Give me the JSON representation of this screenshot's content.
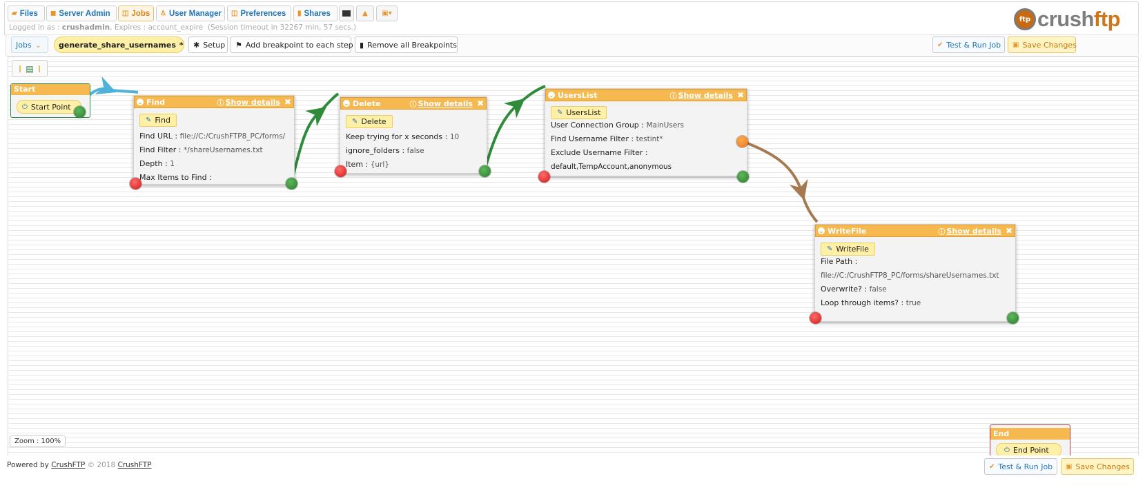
{
  "nav": {
    "tabs": [
      {
        "label": "Files",
        "icon": "folder-icon"
      },
      {
        "label": "Server Admin",
        "icon": "server-icon"
      },
      {
        "label": "Jobs",
        "icon": "jobs-icon",
        "active": true
      },
      {
        "label": "User Manager",
        "icon": "user-icon"
      },
      {
        "label": "Preferences",
        "icon": "preferences-icon"
      },
      {
        "label": "Shares",
        "icon": "shares-icon"
      }
    ]
  },
  "session": {
    "logged_in_label": "Logged in as :",
    "user": "crushadmin",
    "expires_label": ", Expires :",
    "expires_value": "account_expire",
    "timeout": "(Session timeout in 32267 min, 57 secs.)"
  },
  "logo": {
    "word_left": "crush",
    "word_right": "ftp"
  },
  "toolbar": {
    "jobs_label": "Jobs",
    "job_name": "generate_share_usernames",
    "modified_mark": "*",
    "setup_label": "Setup",
    "add_breakpoint_label": "Add breakpoint to each step",
    "remove_breakpoints_label": "Remove all Breakpoints",
    "test_run_label": "Test & Run Job",
    "save_label": "Save Changes"
  },
  "flow": {
    "start": {
      "title": "Start",
      "point_label": "Start Point"
    },
    "end": {
      "title": "End",
      "point_label": "End Point"
    },
    "show_details": "Show details",
    "nodes": [
      {
        "title": "Find",
        "chip": "Find",
        "fields": [
          {
            "label": "Find URL :",
            "value": "file://C:/CrushFTP8_PC/forms/"
          },
          {
            "label": "Find Filter :",
            "value": "*/shareUsernames.txt"
          },
          {
            "label": "Depth :",
            "value": "1"
          },
          {
            "label": "Max Items to Find :",
            "value": ""
          }
        ]
      },
      {
        "title": "Delete",
        "chip": "Delete",
        "fields": [
          {
            "label": "Keep trying for x seconds :",
            "value": "10"
          },
          {
            "label": "ignore_folders :",
            "value": "false"
          },
          {
            "label": "Item :",
            "value": "{url}"
          }
        ]
      },
      {
        "title": "UsersList",
        "chip": "UsersList",
        "fields": [
          {
            "label": "User Connection Group :",
            "value": "MainUsers"
          },
          {
            "label": "Find Username Filter :",
            "value": "testint*"
          },
          {
            "label": "Exclude Username Filter :",
            "value": ""
          },
          {
            "label": "",
            "value": "default,TempAccount,anonymous"
          }
        ]
      },
      {
        "title": "WriteFile",
        "chip": "WriteFile",
        "fields": [
          {
            "label": "File Path :",
            "value": ""
          },
          {
            "label": "",
            "value": "file://C:/CrushFTP8_PC/forms/shareUsernames.txt"
          },
          {
            "label": "Overwrite? :",
            "value": "false"
          },
          {
            "label": "Loop through items? :",
            "value": "true"
          }
        ]
      }
    ]
  },
  "zoom_label": "Zoom : 100%",
  "footer": {
    "powered_by": "Powered by",
    "brand": "CrushFTP",
    "copyright": "© 2018",
    "brand2": "CrushFTP",
    "test_run_label": "Test & Run Job",
    "save_label": "Save Changes"
  },
  "colors": {
    "accent": "#1f76b8",
    "node_header": "#f5b94f",
    "success_line": "#2e8b3a",
    "fail_line": "#a57a50",
    "start_line": "#4fb3d9"
  }
}
